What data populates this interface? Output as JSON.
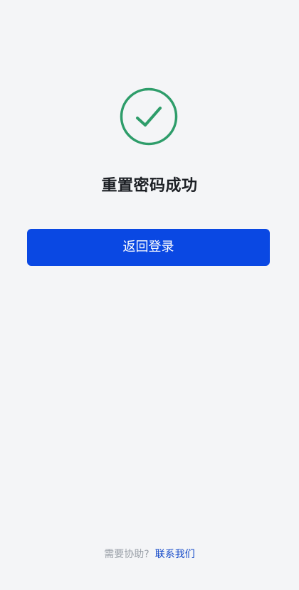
{
  "status": {
    "icon": "check-circle-icon",
    "icon_color": "#2e9d6a",
    "title": "重置密码成功"
  },
  "actions": {
    "back_to_login_label": "返回登录",
    "button_color": "#0a48e3"
  },
  "footer": {
    "help_text": "需要协助?",
    "contact_label": "联系我们",
    "link_color": "#1147c8"
  }
}
